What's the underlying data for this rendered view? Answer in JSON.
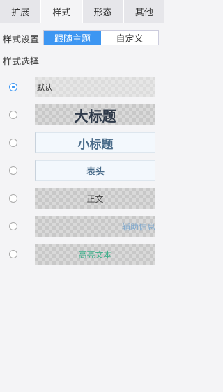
{
  "tabs": [
    {
      "label": "扩展",
      "active": false
    },
    {
      "label": "样式",
      "active": true
    },
    {
      "label": "形态",
      "active": false
    },
    {
      "label": "其他",
      "active": false
    }
  ],
  "style_settings": {
    "label": "样式设置",
    "options": [
      "跟随主题",
      "自定义"
    ],
    "selected": "跟随主题"
  },
  "style_select": {
    "label": "样式选择",
    "items": [
      {
        "text": "默认",
        "checked": true
      },
      {
        "text": "大标题",
        "checked": false
      },
      {
        "text": "小标题",
        "checked": false
      },
      {
        "text": "表头",
        "checked": false
      },
      {
        "text": "正文",
        "checked": false
      },
      {
        "text": "辅助信息",
        "checked": false
      },
      {
        "text": "高亮文本",
        "checked": false
      }
    ]
  },
  "colors": {
    "accent": "#3d96f2",
    "highlight_text": "#3fae8a",
    "aux_text": "#7fa8cc"
  }
}
